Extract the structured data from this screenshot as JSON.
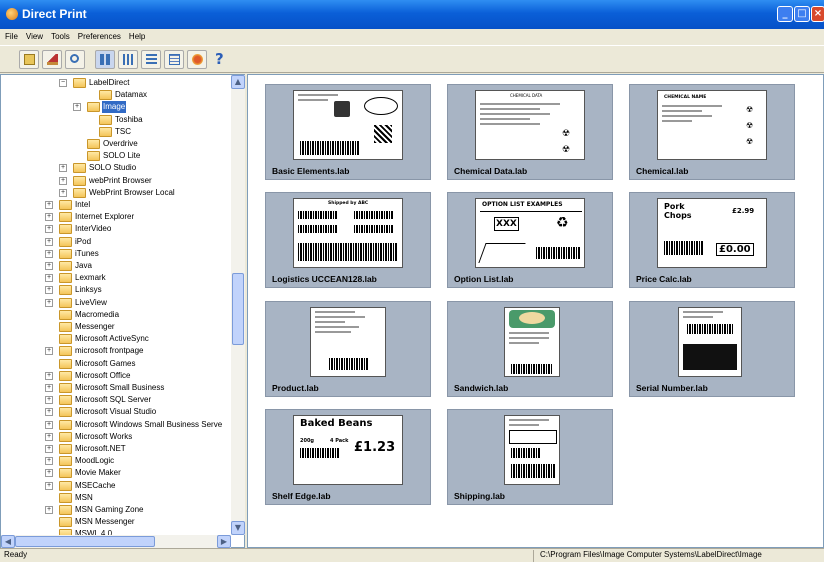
{
  "window": {
    "title": "Direct Print"
  },
  "menu": [
    "File",
    "View",
    "Tools",
    "Preferences",
    "Help"
  ],
  "toolbar": {
    "buttons": [
      "up-folder-icon",
      "home-icon",
      "search-icon",
      "large-icons-view-icon",
      "small-icons-view-icon",
      "list-view-icon",
      "details-view-icon",
      "print-icon",
      "help-icon"
    ],
    "help_label": "?"
  },
  "tree": {
    "items": [
      {
        "label": "LabelDirect",
        "expander": "−"
      },
      {
        "label": "Datamax",
        "expander": ""
      },
      {
        "label": "Image",
        "expander": "+",
        "selected": true
      },
      {
        "label": "Toshiba",
        "expander": ""
      },
      {
        "label": "TSC",
        "expander": ""
      },
      {
        "label": "Overdrive",
        "expander": ""
      },
      {
        "label": "SOLO Lite",
        "expander": ""
      },
      {
        "label": "SOLO Studio",
        "expander": "+"
      },
      {
        "label": "webPrint Browser",
        "expander": "+"
      },
      {
        "label": "WebPrint Browser Local",
        "expander": "+"
      },
      {
        "label": "Intel",
        "expander": "+"
      },
      {
        "label": "Internet Explorer",
        "expander": "+"
      },
      {
        "label": "InterVideo",
        "expander": "+"
      },
      {
        "label": "iPod",
        "expander": "+"
      },
      {
        "label": "iTunes",
        "expander": "+"
      },
      {
        "label": "Java",
        "expander": "+"
      },
      {
        "label": "Lexmark",
        "expander": "+"
      },
      {
        "label": "Linksys",
        "expander": "+"
      },
      {
        "label": "LiveView",
        "expander": "+"
      },
      {
        "label": "Macromedia",
        "expander": ""
      },
      {
        "label": "Messenger",
        "expander": ""
      },
      {
        "label": "Microsoft ActiveSync",
        "expander": ""
      },
      {
        "label": "microsoft frontpage",
        "expander": "+"
      },
      {
        "label": "Microsoft Games",
        "expander": ""
      },
      {
        "label": "Microsoft Office",
        "expander": "+"
      },
      {
        "label": "Microsoft Small Business",
        "expander": "+"
      },
      {
        "label": "Microsoft SQL Server",
        "expander": "+"
      },
      {
        "label": "Microsoft Visual Studio",
        "expander": "+"
      },
      {
        "label": "Microsoft Windows Small Business Serve",
        "expander": "+"
      },
      {
        "label": "Microsoft Works",
        "expander": "+"
      },
      {
        "label": "Microsoft.NET",
        "expander": "+"
      },
      {
        "label": "MoodLogic",
        "expander": "+"
      },
      {
        "label": "Movie Maker",
        "expander": "+"
      },
      {
        "label": "MSECache",
        "expander": "+"
      },
      {
        "label": "MSN",
        "expander": ""
      },
      {
        "label": "MSN Gaming Zone",
        "expander": "+"
      },
      {
        "label": "MSN Messenger",
        "expander": ""
      },
      {
        "label": "MSWL 4.0",
        "expander": ""
      }
    ]
  },
  "labels": [
    {
      "caption": "Basic Elements.lab"
    },
    {
      "caption": "Chemical Data.lab",
      "thumb_text": "CHEMICAL DATA"
    },
    {
      "caption": "Chemical.lab",
      "thumb_text": "CHEMICAL NAME"
    },
    {
      "caption": "Logistics UCCEAN128.lab",
      "thumb_text": "Shipped by ABC"
    },
    {
      "caption": "Option List.lab",
      "thumb_text": "OPTION LIST EXAMPLES",
      "thumb_text2": "XXX"
    },
    {
      "caption": "Price Calc.lab",
      "thumb_text": "Pork Chops",
      "thumb_text2": "£0.00",
      "thumb_text3": "£2.99"
    },
    {
      "caption": "Product.lab"
    },
    {
      "caption": "Sandwich.lab"
    },
    {
      "caption": "Serial Number.lab"
    },
    {
      "caption": "Shelf Edge.lab",
      "thumb_text": "Baked Beans",
      "thumb_text2": "£1.23",
      "thumb_text3": "200g",
      "thumb_text4": "4 Pack"
    },
    {
      "caption": "Shipping.lab"
    }
  ],
  "status": {
    "ready": "Ready",
    "path": "C:\\Program Files\\Image Computer Systems\\LabelDirect\\Image"
  },
  "colors": {
    "titlebar": "#0a5fd8",
    "selection": "#316ac5",
    "card": "#a8b4c4"
  }
}
